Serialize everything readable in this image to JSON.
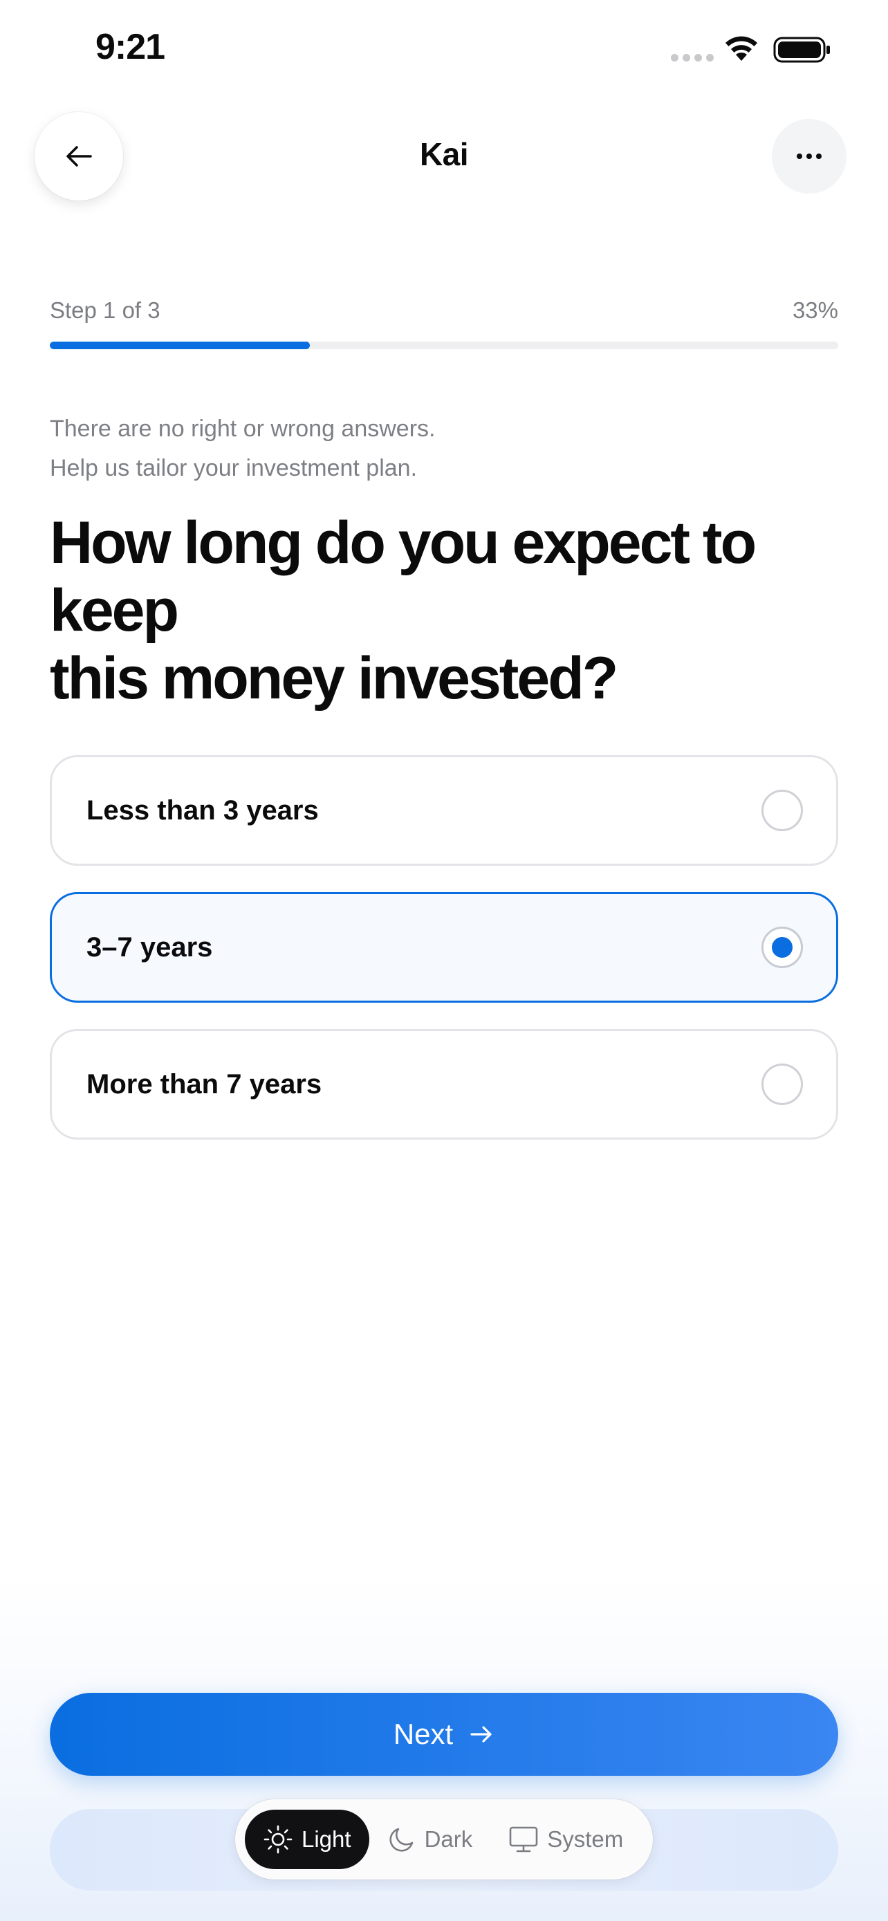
{
  "status_bar": {
    "time": "9:21"
  },
  "nav": {
    "title": "Kai",
    "back_icon": "arrow-left-icon",
    "more_icon": "more-horizontal-icon"
  },
  "progress": {
    "step_label": "Step 1 of 3",
    "percent_label": "33%",
    "fraction": 0.33
  },
  "helper": {
    "line1": "There are no right or wrong answers.",
    "line2": "Help us tailor your investment plan."
  },
  "question": {
    "line1": "How long do you expect to keep",
    "line2": "this money invested?"
  },
  "options": [
    {
      "label": "Less than 3 years",
      "selected": false
    },
    {
      "label": "3–7 years",
      "selected": true
    },
    {
      "label": "More than 7 years",
      "selected": false
    }
  ],
  "next_button": {
    "label": "Next",
    "icon": "arrow-right-icon"
  },
  "theme": {
    "options": [
      {
        "label": "Light",
        "icon": "sun-icon",
        "active": true
      },
      {
        "label": "Dark",
        "icon": "moon-icon",
        "active": false
      },
      {
        "label": "System",
        "icon": "monitor-icon",
        "active": false
      }
    ]
  },
  "colors": {
    "accent": "#0a6ee0",
    "text": "#0b0b0c",
    "muted": "#7d7f85"
  }
}
